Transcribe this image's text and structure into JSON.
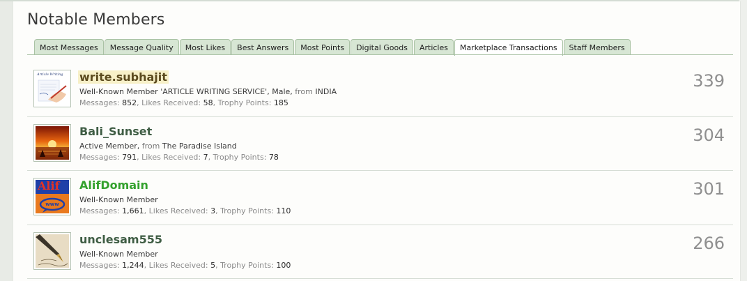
{
  "page": {
    "title": "Notable Members"
  },
  "tabs": [
    {
      "label": "Most Messages",
      "active": false
    },
    {
      "label": "Message Quality",
      "active": false
    },
    {
      "label": "Most Likes",
      "active": false
    },
    {
      "label": "Best Answers",
      "active": false
    },
    {
      "label": "Most Points",
      "active": false
    },
    {
      "label": "Digital Goods",
      "active": false
    },
    {
      "label": "Articles",
      "active": false
    },
    {
      "label": "Marketplace Transactions",
      "active": true
    },
    {
      "label": "Staff Members",
      "active": false
    }
  ],
  "members": [
    {
      "name": "write.subhajit",
      "title": "Well-Known Member",
      "custom_title": "'ARTICLE WRITING SERVICE'",
      "gender": "Male",
      "from_label": "from",
      "location": "INDIA",
      "messages_label": "Messages:",
      "messages": "852",
      "likes_label": "Likes Received:",
      "likes": "58",
      "points_label": "Trophy Points:",
      "points": "185",
      "count": "339",
      "avatar_text": "Article Writing"
    },
    {
      "name": "Bali_Sunset",
      "title": "Active Member",
      "from_label": "from",
      "location": "The Paradise Island",
      "messages_label": "Messages:",
      "messages": "791",
      "likes_label": "Likes Received:",
      "likes": "7",
      "points_label": "Trophy Points:",
      "points": "78",
      "count": "304"
    },
    {
      "name": "AlifDomain",
      "title": "Well-Known Member",
      "messages_label": "Messages:",
      "messages": "1,661",
      "likes_label": "Likes Received:",
      "likes": "3",
      "points_label": "Trophy Points:",
      "points": "110",
      "count": "301",
      "avatar_text": "Alif",
      "avatar_sub": "www"
    },
    {
      "name": "unclesam555",
      "title": "Well-Known Member",
      "messages_label": "Messages:",
      "messages": "1,244",
      "likes_label": "Likes Received:",
      "likes": "5",
      "points_label": "Trophy Points:",
      "points": "100",
      "count": "266"
    }
  ],
  "colors": {
    "tab_bg": "#d7e6d4",
    "tab_border": "#a9c2a4",
    "username": "#3f5d44",
    "username_green": "#33a12d",
    "count": "#8f8f8f"
  }
}
